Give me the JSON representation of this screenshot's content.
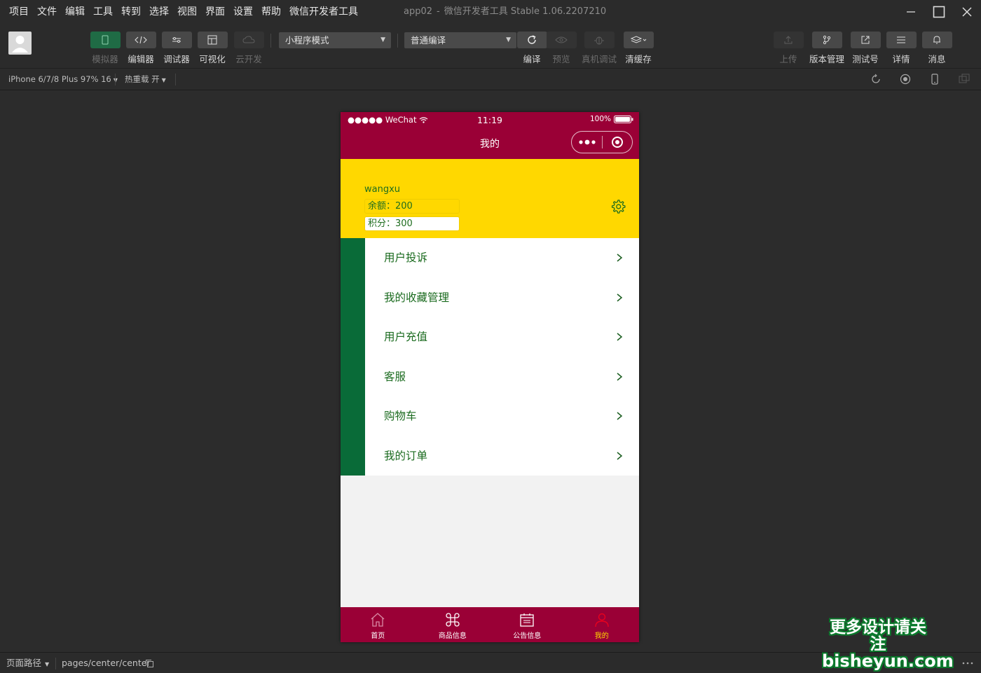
{
  "menubar": {
    "items": [
      "项目",
      "文件",
      "编辑",
      "工具",
      "转到",
      "选择",
      "视图",
      "界面",
      "设置",
      "帮助",
      "微信开发者工具"
    ]
  },
  "window": {
    "title_app": "app02",
    "title_sep": "-",
    "title_tool": "微信开发者工具 Stable 1.06.2207210"
  },
  "toolbar": {
    "simulator_label": "模拟器",
    "editor_label": "编辑器",
    "debugger_label": "调试器",
    "visual_label": "可视化",
    "cloud_label": "云开发",
    "mode_select": "小程序模式",
    "compile_select": "普通编译",
    "compile_label": "编译",
    "preview_label": "预览",
    "realdebug_label": "真机调试",
    "clearcache_label": "清缓存",
    "upload_label": "上传",
    "version_label": "版本管理",
    "testid_label": "测试号",
    "detail_label": "详情",
    "message_label": "消息"
  },
  "subbar": {
    "device": "iPhone 6/7/8 Plus 97% 16",
    "hotreload": "热重载 开"
  },
  "phone": {
    "status": {
      "carrier": "●●●●● WeChat",
      "time": "11:19",
      "battery": "100%"
    },
    "nav_title": "我的",
    "profile": {
      "username": "wangxu",
      "balance": "余额：200",
      "points": "积分：300"
    },
    "menu": [
      {
        "label": "用户投诉"
      },
      {
        "label": "我的收藏管理"
      },
      {
        "label": "用户充值"
      },
      {
        "label": "客服"
      },
      {
        "label": "购物车"
      },
      {
        "label": "我的订单"
      }
    ],
    "tabs": [
      {
        "label": "首页",
        "icon": "home-icon"
      },
      {
        "label": "商品信息",
        "icon": "command-icon"
      },
      {
        "label": "公告信息",
        "icon": "calendar-icon"
      },
      {
        "label": "我的",
        "icon": "user-icon"
      }
    ]
  },
  "bottombar": {
    "path_label": "页面路径",
    "path_value": "pages/center/center"
  },
  "watermark": {
    "line1": "更多设计请关注",
    "line2": "bisheyun.com"
  },
  "colors": {
    "nav": "#9a0036",
    "profile": "#ffd800",
    "accent_green": "#096b38",
    "text_green": "#1b6b1f"
  }
}
